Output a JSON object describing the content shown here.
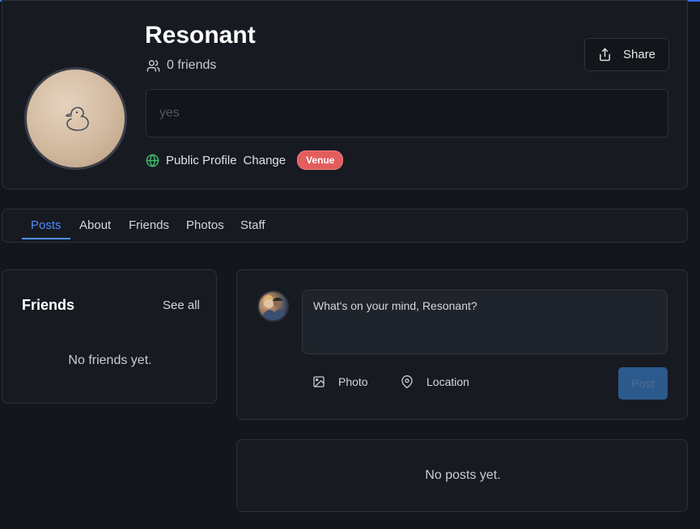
{
  "profile": {
    "name": "Resonant",
    "friends_count": "0 friends",
    "share_label": "Share",
    "bio_placeholder": "yes",
    "visibility_label": "Public Profile",
    "change_label": "Change",
    "badge": "Venue"
  },
  "tabs": [
    {
      "label": "Posts",
      "active": true
    },
    {
      "label": "About"
    },
    {
      "label": "Friends"
    },
    {
      "label": "Photos"
    },
    {
      "label": "Staff"
    }
  ],
  "friends_panel": {
    "title": "Friends",
    "see_all": "See all",
    "empty": "No friends yet."
  },
  "composer": {
    "placeholder": "What's on your mind, Resonant?",
    "photo_label": "Photo",
    "location_label": "Location",
    "post_label": "Post"
  },
  "posts": {
    "empty": "No posts yet."
  },
  "colors": {
    "accent": "#4f8cf7",
    "badge": "#e35d5d",
    "globe": "#3fbf6f",
    "background": "#13161c",
    "card": "#171a21"
  },
  "icons": {
    "friends": "users-icon",
    "share": "share-icon",
    "visibility": "globe-icon",
    "photo": "image-icon",
    "location": "map-pin-icon"
  }
}
